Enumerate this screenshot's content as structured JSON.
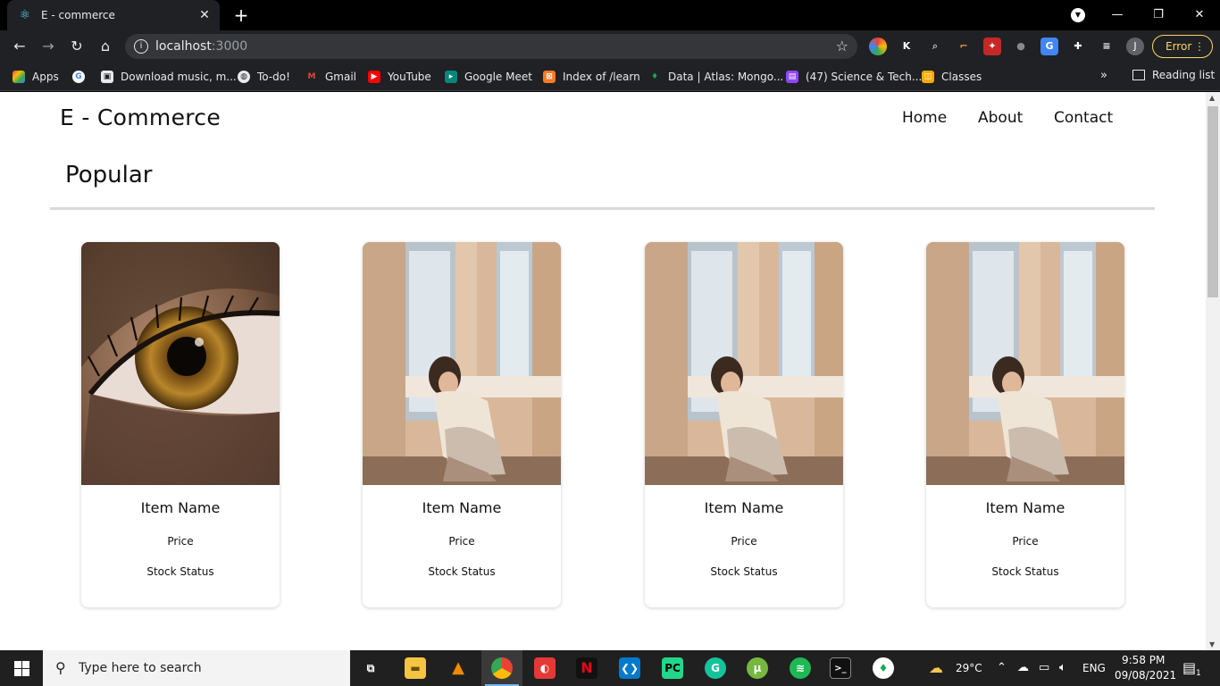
{
  "browser": {
    "tab_title": "E - commerce",
    "url_host": "localhost",
    "url_port": ":3000",
    "error_label": "Error",
    "avatar_initial": "J",
    "bookmarks": [
      {
        "label": "Apps",
        "icon": "apps-grid-icon",
        "color": "#ea4335"
      },
      {
        "label": "",
        "icon": "google-icon",
        "color": "#4285f4"
      },
      {
        "label": "Download music, m...",
        "icon": "download-icon",
        "color": "#5f6368"
      },
      {
        "label": "To-do!",
        "icon": "globe-icon",
        "color": "#5f6368"
      },
      {
        "label": "Gmail",
        "icon": "gmail-icon",
        "color": "#ea4335"
      },
      {
        "label": "YouTube",
        "icon": "youtube-icon",
        "color": "#ff0000"
      },
      {
        "label": "Google Meet",
        "icon": "meet-icon",
        "color": "#00897b"
      },
      {
        "label": "Index of /learn",
        "icon": "xampp-icon",
        "color": "#fb7a24"
      },
      {
        "label": "Data | Atlas: Mongo...",
        "icon": "mongodb-leaf-icon",
        "color": "#13aa52"
      },
      {
        "label": "(47) Science & Tech...",
        "icon": "twitch-icon",
        "color": "#9146ff"
      },
      {
        "label": "Classes",
        "icon": "classroom-icon",
        "color": "#f9ab00"
      }
    ],
    "reading_list_label": "Reading list"
  },
  "site": {
    "logo": "E - Commerce",
    "nav": [
      "Home",
      "About",
      "Contact"
    ],
    "section_title": "Popular",
    "products": [
      {
        "name": "Item Name",
        "price": "Price",
        "stock": "Stock Status",
        "image": "eye-closeup"
      },
      {
        "name": "Item Name",
        "price": "Price",
        "stock": "Stock Status",
        "image": "woman-by-window"
      },
      {
        "name": "Item Name",
        "price": "Price",
        "stock": "Stock Status",
        "image": "woman-by-window"
      },
      {
        "name": "Item Name",
        "price": "Price",
        "stock": "Stock Status",
        "image": "woman-by-window"
      }
    ]
  },
  "taskbar": {
    "search_placeholder": "Type here to search",
    "weather": "29°C",
    "language": "ENG",
    "time": "9:58 PM",
    "date": "09/08/2021",
    "notification_count": "1"
  }
}
